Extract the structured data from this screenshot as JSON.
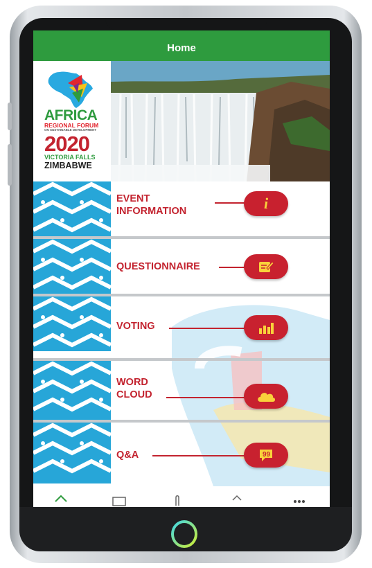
{
  "screen": {
    "title": "Home"
  },
  "banner": {
    "logo_lines": [
      "AFRICA",
      "REGIONAL FORUM",
      "ON SUSTAINABLE DEVELOPMENT",
      "2020",
      "VICTORIA FALLS",
      "ZIMBABWE"
    ]
  },
  "menu": [
    {
      "label_line1": "EVENT",
      "label_line2": "INFORMATION",
      "icon": "info-icon"
    },
    {
      "label_line1": "QUESTIONNAIRE",
      "label_line2": "",
      "icon": "note-edit-icon"
    },
    {
      "label_line1": "VOTING",
      "label_line2": "",
      "icon": "bar-chart-icon"
    },
    {
      "label_line1": "WORD",
      "label_line2": "CLOUD",
      "icon": "cloud-icon"
    },
    {
      "label_line1": "Q&A",
      "label_line2": "",
      "icon": "speech-bubble-icon"
    }
  ],
  "bottom_nav": [
    "home-icon",
    "id-card-icon",
    "touch-icon",
    "tag-icon",
    "more-icon"
  ],
  "colors": {
    "header_green": "#2e9b3e",
    "accent_red": "#c8212f",
    "pattern_blue": "#27a6d8"
  }
}
